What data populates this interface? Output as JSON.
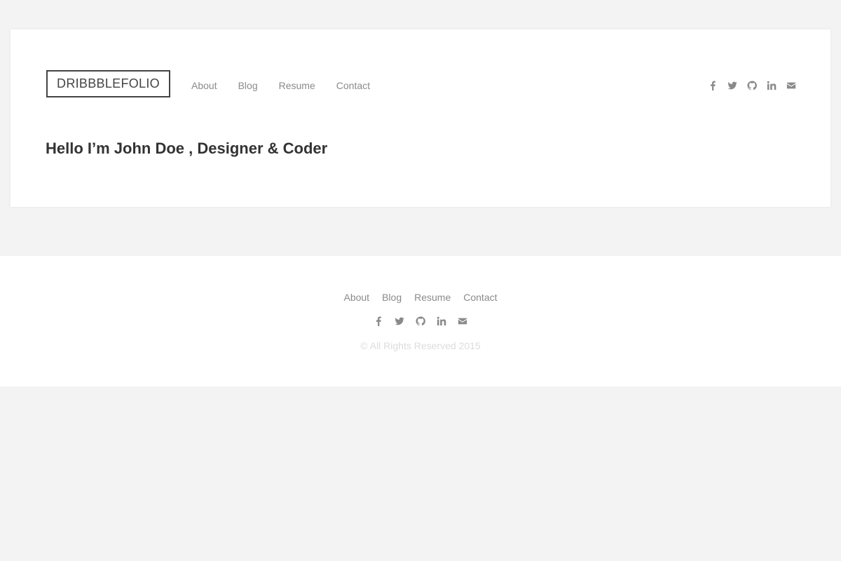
{
  "header": {
    "logo": "DRIBBBLEFOLIO",
    "nav": [
      "About",
      "Blog",
      "Resume",
      "Contact"
    ],
    "social_icons": [
      "facebook-icon",
      "twitter-icon",
      "github-icon",
      "linkedin-icon",
      "envelope-icon"
    ],
    "tagline": "Hello I’m John Doe , Designer & Coder"
  },
  "footer": {
    "nav": [
      "About",
      "Blog",
      "Resume",
      "Contact"
    ],
    "social_icons": [
      "facebook-icon",
      "twitter-icon",
      "github-icon",
      "linkedin-icon",
      "envelope-icon"
    ],
    "copyright": "© All Rights Reserved 2015"
  },
  "colors": {
    "page_background": "#f3f3f3",
    "card_background": "#ffffff",
    "text_dark": "#333333",
    "text_muted": "#8a8a8a",
    "text_faint": "#dcdcdc"
  }
}
